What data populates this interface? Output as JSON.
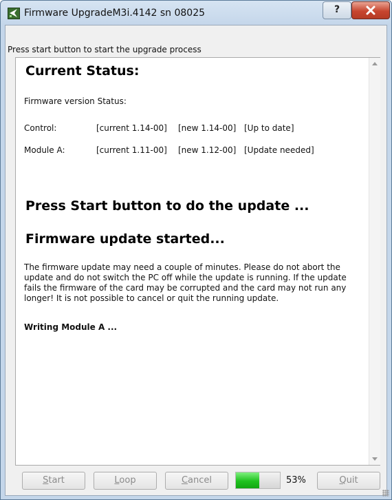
{
  "window": {
    "title": "Firmware UpgradeM3i.4142 sn 08025",
    "help_label": "?",
    "instruction": "Press start button to start the upgrade process"
  },
  "log": {
    "current_status_heading": "Current Status:",
    "fw_version_status": "Firmware version Status:",
    "rows": [
      {
        "name": "Control:",
        "current": "[current 1.14-00]",
        "new": "[new 1.14-00]",
        "state": "[Up to date]"
      },
      {
        "name": "Module A:",
        "current": "[current 1.11-00]",
        "new": "[new 1.12-00]",
        "state": "[Update needed]"
      }
    ],
    "press_start_heading": "Press Start button to do the update ...",
    "started_heading": "Firmware update started...",
    "warning_text": "The firmware update may need a couple of minutes. Please do not abort the update and do not switch the PC off while the update is running. If the update fails the firmware of the card may be corrupted and the card may not run any longer! It is not possible to cancel or quit the running update.",
    "writing_text": "Writing Module A ..."
  },
  "buttons": {
    "start": {
      "mnemonic": "S",
      "rest": "tart"
    },
    "loop": {
      "mnemonic": "L",
      "rest": "oop"
    },
    "cancel": {
      "mnemonic": "C",
      "rest": "ancel"
    },
    "quit": {
      "mnemonic": "Q",
      "rest": "uit"
    }
  },
  "progress": {
    "value": 53,
    "label": "53%",
    "color": "#1fc21f"
  }
}
